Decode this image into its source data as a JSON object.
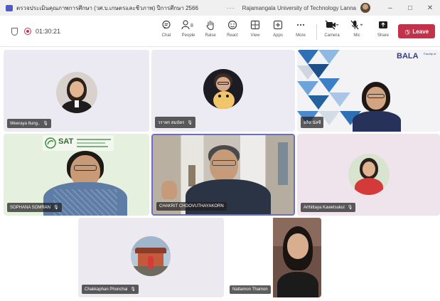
{
  "window": {
    "title": "ตรวจประเมินคุณภาพการศึกษา (วศ.บ.เกษตรและชีวภาพ) ปีการศึกษา 2566",
    "more": "···",
    "org": "Rajamangala University of Technology Lanna",
    "minimize": "–",
    "maximize": "□",
    "close": "✕"
  },
  "toolbar": {
    "timer": "01:30:21",
    "buttons": [
      {
        "label": "Chat",
        "icon": "chat-icon"
      },
      {
        "label": "People",
        "icon": "people-icon",
        "count": "8"
      },
      {
        "label": "Raise",
        "icon": "raise-hand-icon"
      },
      {
        "label": "React",
        "icon": "react-icon"
      },
      {
        "label": "View",
        "icon": "view-icon"
      },
      {
        "label": "Apps",
        "icon": "apps-icon"
      },
      {
        "label": "More",
        "icon": "more-icon"
      },
      {
        "label": "Camera",
        "icon": "camera-off-icon"
      },
      {
        "label": "Mic",
        "icon": "mic-off-icon"
      },
      {
        "label": "Share",
        "icon": "share-icon"
      }
    ],
    "leave": "Leave",
    "leave_color": "#c4314b"
  },
  "participants": [
    {
      "name": "Weeraya Itung..",
      "muted": true,
      "type": "avatar"
    },
    {
      "name": "วราพร สมบัตร",
      "muted": true,
      "type": "avatar"
    },
    {
      "name": "อลิส นัสซี",
      "muted": false,
      "type": "video",
      "logo": "BALA",
      "logo_sub": "Faculty of"
    },
    {
      "name": "SOPHANA SOMRAN",
      "muted": true,
      "type": "video",
      "logo": "SAT"
    },
    {
      "name": "CHAKRIT CHOOVUTHAYAKORN",
      "muted": false,
      "type": "video",
      "active": true
    },
    {
      "name": "Arthittaya Kawetsukul",
      "muted": true,
      "type": "avatar"
    },
    {
      "name": "Chakkaphan Phonchai",
      "muted": true,
      "type": "avatar"
    },
    {
      "name": "Nattamon Thamon",
      "muted": false,
      "type": "video"
    }
  ],
  "colors": {
    "accent": "#6b6fc4",
    "recording": "#c4314b"
  }
}
